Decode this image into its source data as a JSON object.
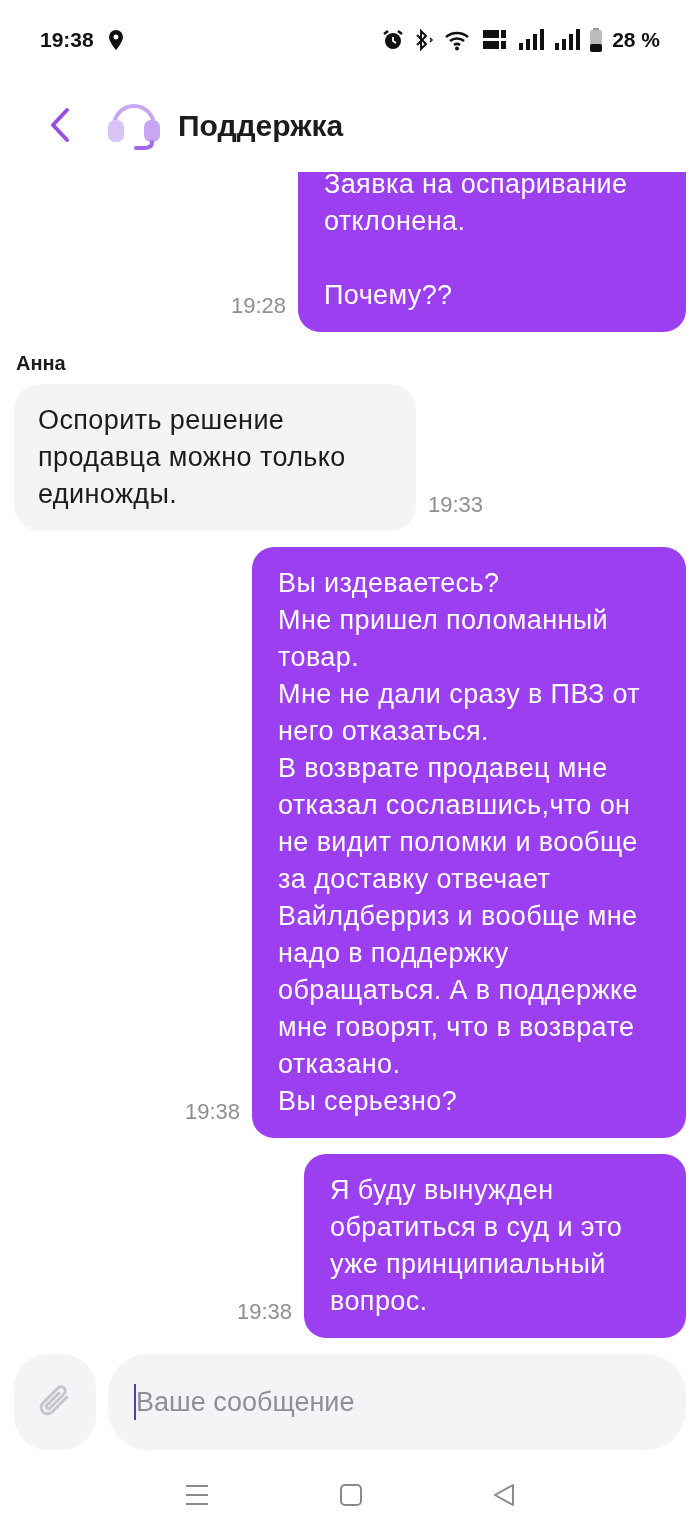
{
  "status_bar": {
    "time": "19:38",
    "battery": "28 %"
  },
  "header": {
    "title": "Поддержка"
  },
  "messages": [
    {
      "kind": "outgoing",
      "text": "Заявка на оспаривание\nотклонена.\n\nПочему??",
      "time": "19:28"
    },
    {
      "kind": "incoming",
      "sender": "Анна",
      "text": "Оспорить решение продавца можно только единожды.",
      "time": "19:33"
    },
    {
      "kind": "outgoing",
      "text": "Вы издеваетесь?\nМне пришел поломанный товар.\nМне не дали сразу в ПВЗ от него отказаться.\nВ возврате продавец мне отказал сославшись,что он не видит поломки и вообще за доставку отвечает Вайлдберриз и вообще мне надо в поддержку обращаться. А в поддержке мне говорят, что в возврате отказано.\nВы серьезно?",
      "time": "19:38"
    },
    {
      "kind": "outgoing",
      "text": "Я буду вынужден обратиться в суд и это уже принципиальный вопрос.",
      "time": "19:38"
    }
  ],
  "composer": {
    "placeholder": "Ваше сообщение"
  }
}
